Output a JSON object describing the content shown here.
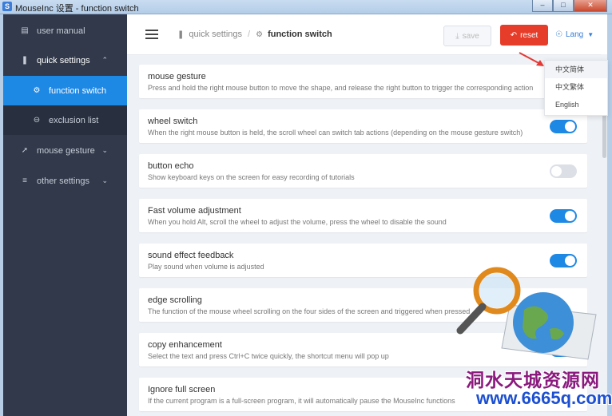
{
  "window": {
    "title": "MouseInc 设置 - function switch",
    "app_icon": "S"
  },
  "sidebar": {
    "items": [
      {
        "label": "user manual",
        "icon": "book-icon"
      },
      {
        "label": "quick settings",
        "icon": "lightning-icon",
        "expanded": true
      },
      {
        "label": "function switch",
        "icon": "gear-icon",
        "active": true
      },
      {
        "label": "exclusion list",
        "icon": "minus-circle-icon"
      },
      {
        "label": "mouse gesture",
        "icon": "pointer-icon"
      },
      {
        "label": "other settings",
        "icon": "sliders-icon"
      }
    ]
  },
  "header": {
    "breadcrumb": {
      "parent": "quick settings",
      "current": "function switch"
    },
    "save_label": "save",
    "reset_label": "reset",
    "lang_label": "Lang"
  },
  "settings": [
    {
      "title": "mouse gesture",
      "desc": "Press and hold the right mouse button to move the shape, and release the right button to trigger the corresponding action",
      "on": true
    },
    {
      "title": "wheel switch",
      "desc": "When the right mouse button is held, the scroll wheel can switch tab actions (depending on the mouse gesture switch)",
      "on": true
    },
    {
      "title": "button echo",
      "desc": "Show keyboard keys on the screen for easy recording of tutorials",
      "on": false
    },
    {
      "title": "Fast volume adjustment",
      "desc": "When you hold Alt, scroll the wheel to adjust the volume, press the wheel to disable the sound",
      "on": true
    },
    {
      "title": "sound effect feedback",
      "desc": "Play sound when volume is adjusted",
      "on": true
    },
    {
      "title": "edge scrolling",
      "desc": "The function of the mouse wheel scrolling on the four sides of the screen and triggered when pressed",
      "on": true
    },
    {
      "title": "copy enhancement",
      "desc": "Select the text and press Ctrl+C twice quickly, the shortcut menu will pop up",
      "on": true
    },
    {
      "title": "Ignore full screen",
      "desc": "If the current program is a full-screen program, it will automatically pause the MouseInc functions",
      "on": true
    }
  ],
  "lang_menu": {
    "options": [
      "中文简体",
      "中文繁体",
      "English"
    ],
    "selected": 0
  },
  "watermark": {
    "text": "洞水天城资源网",
    "url": "www.6665q.com"
  },
  "colors": {
    "accent": "#1e88e5",
    "danger": "#e63d2a",
    "sidebar_bg": "#31394a"
  }
}
